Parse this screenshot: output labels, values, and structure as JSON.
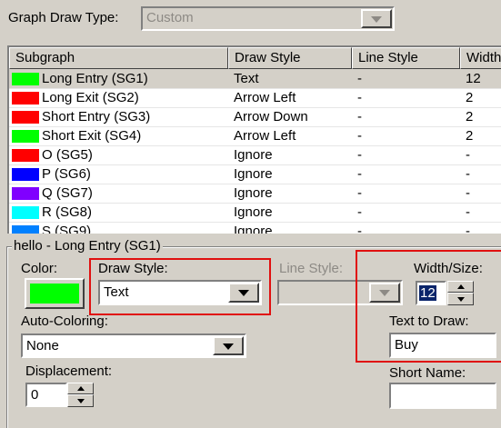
{
  "graph_draw_type": {
    "label": "Graph Draw Type:",
    "value": "Custom"
  },
  "table": {
    "columns": [
      "Subgraph",
      "Draw Style",
      "Line Style",
      "Width"
    ],
    "rows": [
      {
        "name": "Long Entry (SG1)",
        "color": "#00ff00",
        "draw_style": "Text",
        "line_style": "-",
        "width": "12",
        "selected": true
      },
      {
        "name": "Long Exit (SG2)",
        "color": "#ff0000",
        "draw_style": "Arrow Left",
        "line_style": "-",
        "width": "2"
      },
      {
        "name": "Short Entry (SG3)",
        "color": "#ff0000",
        "draw_style": "Arrow Down",
        "line_style": "-",
        "width": "2"
      },
      {
        "name": "Short Exit (SG4)",
        "color": "#00ff00",
        "draw_style": "Arrow Left",
        "line_style": "-",
        "width": "2"
      },
      {
        "name": "O (SG5)",
        "color": "#ff0000",
        "draw_style": "Ignore",
        "line_style": "-",
        "width": "-"
      },
      {
        "name": "P (SG6)",
        "color": "#0000ff",
        "draw_style": "Ignore",
        "line_style": "-",
        "width": "-"
      },
      {
        "name": "Q (SG7)",
        "color": "#8000ff",
        "draw_style": "Ignore",
        "line_style": "-",
        "width": "-"
      },
      {
        "name": "R (SG8)",
        "color": "#00ffff",
        "draw_style": "Ignore",
        "line_style": "-",
        "width": "-"
      },
      {
        "name": "S (SG9)",
        "color": "#0080ff",
        "draw_style": "Ignore",
        "line_style": "-",
        "width": "-"
      }
    ]
  },
  "group": {
    "title": "hello - Long Entry (SG1)",
    "color_label": "Color:",
    "color_value": "#00ff00",
    "draw_style_label": "Draw Style:",
    "draw_style_value": "Text",
    "line_style_label": "Line Style:",
    "width_label": "Width/Size:",
    "width_value": "12",
    "auto_coloring_label": "Auto-Coloring:",
    "auto_coloring_value": "None",
    "text_to_draw_label": "Text to Draw:",
    "text_to_draw_value": "Buy",
    "displacement_label": "Displacement:",
    "displacement_value": "0",
    "short_name_label": "Short Name:",
    "short_name_value": ""
  },
  "colors": {
    "highlight_box": "#e01010",
    "selection": "#0a246a"
  }
}
